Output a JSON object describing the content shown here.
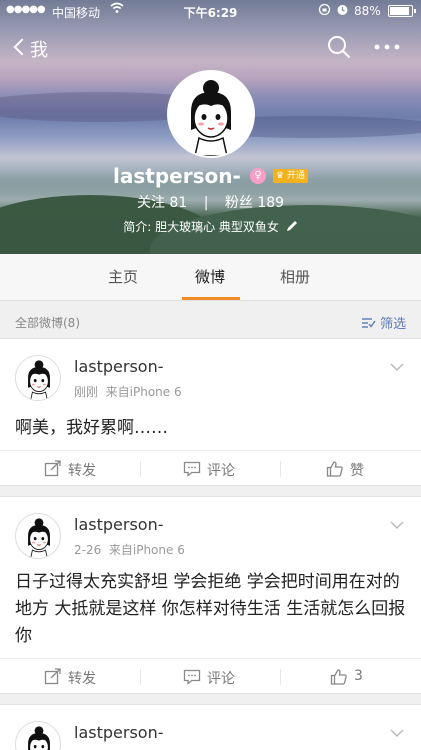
{
  "status_bar": {
    "signal": "●●●●●",
    "carrier": "中国移动",
    "time": "下午6:29",
    "battery": "88%"
  },
  "nav": {
    "back_label": "我"
  },
  "profile": {
    "name": "lastperson-",
    "vip_label": "开通",
    "following_label": "关注",
    "following_count": "81",
    "followers_label": "粉丝",
    "followers_count": "189",
    "bio": "简介: 胆大玻璃心 典型双鱼女"
  },
  "tabs": [
    "主页",
    "微博",
    "相册"
  ],
  "active_tab": "微博",
  "filter": {
    "count_label": "全部微博(8)",
    "filter_label": "筛选"
  },
  "posts": [
    {
      "author": "lastperson-",
      "time": "刚刚",
      "source": "来自iPhone 6",
      "text": "啊美，我好累啊……",
      "repost_label": "转发",
      "comment_label": "评论",
      "like_label": "赞"
    },
    {
      "author": "lastperson-",
      "time": "2-26",
      "source": "来自iPhone 6",
      "text": "日子过得太充实舒坦   学会拒绝   学会把时间用在对的地方  大抵就是这样  你怎样对待生活 生活就怎么回报你",
      "repost_label": "转发",
      "comment_label": "评论",
      "like_label": "3"
    },
    {
      "author": "lastperson-"
    }
  ],
  "colors": {
    "accent": "#f28c28",
    "link": "#5b7bb5"
  }
}
